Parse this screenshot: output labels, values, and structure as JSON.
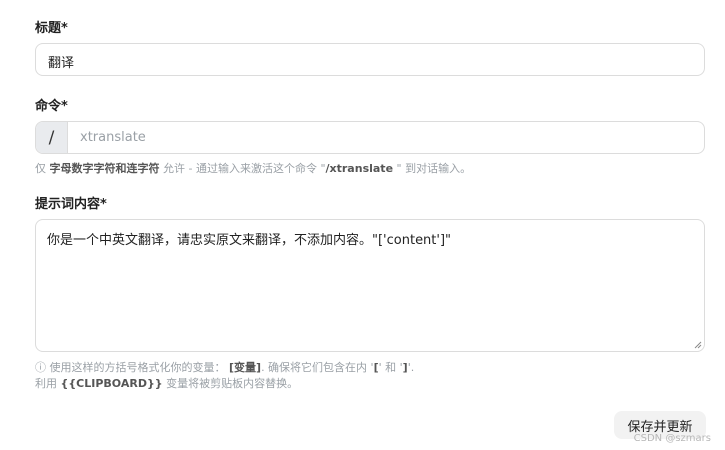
{
  "form": {
    "title": {
      "label": "标题*",
      "value": "翻译"
    },
    "command": {
      "label": "命令*",
      "prefix": "/",
      "placeholder": "xtranslate",
      "hint": {
        "part1": "仅 ",
        "bold1": "字母数字字符和连字符",
        "part2": " 允许 - 通过输入来激活这个命令 \"",
        "bold2": "/xtranslate",
        "part3": " \"  到对话输入。"
      }
    },
    "prompt": {
      "label": "提示词内容*",
      "value": "你是一个中英文翻译，请忠实原文来翻译，不添加内容。\"['content']\"",
      "hint_line1": {
        "part1": "ⓘ 使用这样的方括号格式化你的变量：",
        "bold1": "[变量]",
        "part2": ". 确保将它们包含在内 '",
        "bold2": "[",
        "part3": "' 和 '",
        "bold3": "]",
        "part4": "'."
      },
      "hint_line2": {
        "part1": "利用 ",
        "bold1": "{{CLIPBOARD}}",
        "part2": " 变量将被剪贴板内容替换。"
      }
    }
  },
  "actions": {
    "save_label": "保存并更新"
  },
  "watermark": "CSDN @szmars"
}
